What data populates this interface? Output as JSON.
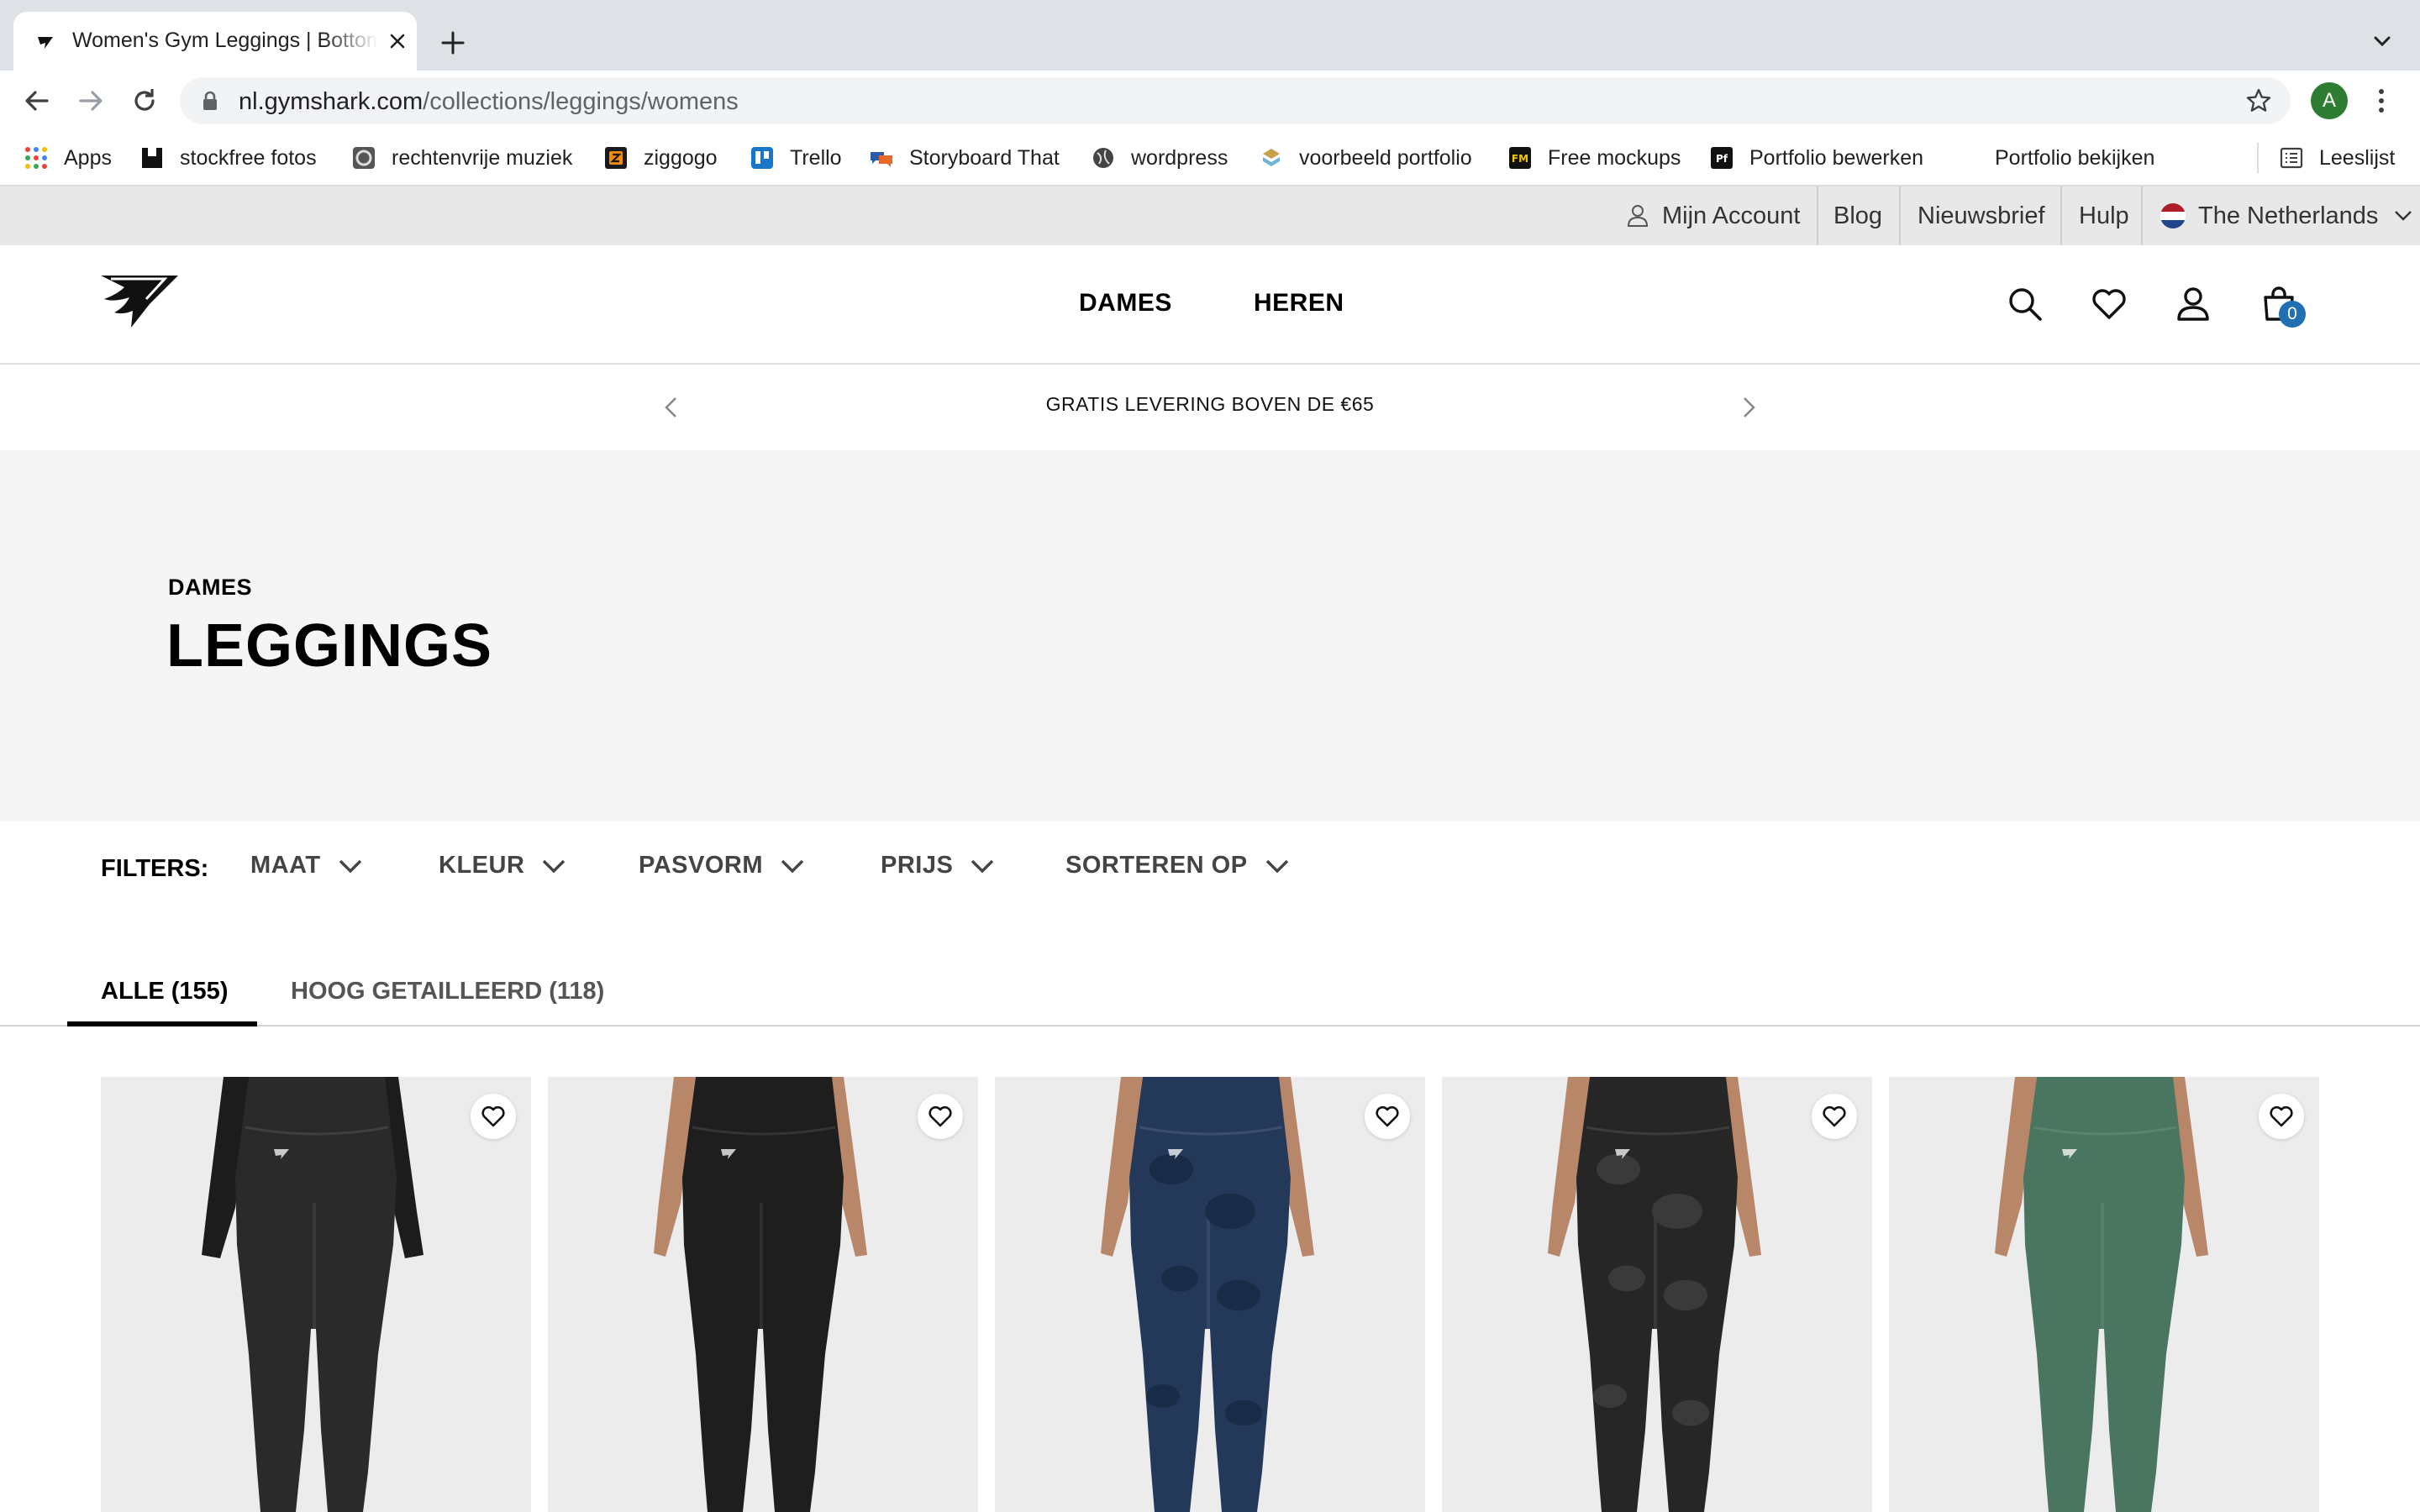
{
  "browser": {
    "tab": {
      "title": "Women's Gym Leggings | Bottoms | Gymshark",
      "close_icon": "close-icon"
    },
    "new_tab_label": "+",
    "address": {
      "host": "nl.gymshark.com",
      "path": "/collections/leggings/womens"
    },
    "profile_initial": "A",
    "bookmarks": [
      {
        "label": "Apps",
        "icon": "apps-grid-icon"
      },
      {
        "label": "stockfree fotos",
        "icon": "stockfree-icon"
      },
      {
        "label": "rechtenvrije muziek",
        "icon": "music-icon"
      },
      {
        "label": "ziggogo",
        "icon": "ziggo-icon"
      },
      {
        "label": "Trello",
        "icon": "trello-icon"
      },
      {
        "label": "Storyboard That",
        "icon": "storyboard-icon"
      },
      {
        "label": "wordpress",
        "icon": "globe-icon"
      },
      {
        "label": "voorbeeld portfolio",
        "icon": "portfolio-icon"
      },
      {
        "label": "Free mockups",
        "icon": "fm-icon"
      },
      {
        "label": "Portfolio bewerken",
        "icon": "pf-icon"
      },
      {
        "label": "Portfolio bekijken",
        "icon": ""
      }
    ],
    "reading_list_label": "Leeslijst"
  },
  "utility_bar": {
    "account": "Mijn Account",
    "blog": "Blog",
    "newsletter": "Nieuwsbrief",
    "help": "Hulp",
    "country": "The Netherlands"
  },
  "header": {
    "nav": [
      "DAMES",
      "HEREN"
    ],
    "cart_count": "0"
  },
  "promo": {
    "text": "GRATIS LEVERING BOVEN DE €65"
  },
  "hero": {
    "eyebrow": "DAMES",
    "title": "LEGGINGS"
  },
  "filters": {
    "label": "FILTERS:",
    "items": [
      "MAAT",
      "KLEUR",
      "PASVORM",
      "PRIJS",
      "SORTEREN OP"
    ]
  },
  "tabs": [
    {
      "label": "ALLE (155)",
      "active": true
    },
    {
      "label": "HOOG GETAILLEERD (118)",
      "active": false
    }
  ],
  "products": [
    {
      "color_name": "black",
      "legging_color": "#2a2a2a",
      "top": "long-sleeve"
    },
    {
      "color_name": "black",
      "legging_color": "#1e1e1e",
      "top": "none"
    },
    {
      "color_name": "navy camo",
      "legging_color": "#24395a",
      "top": "none"
    },
    {
      "color_name": "black camo",
      "legging_color": "#262626",
      "top": "none"
    },
    {
      "color_name": "green",
      "legging_color": "#4a7560",
      "top": "none"
    }
  ],
  "colors": {
    "cart_badge": "#1f6fb2",
    "hero_bg": "#f5f5f5",
    "utility_bg": "#e8e8e8"
  }
}
